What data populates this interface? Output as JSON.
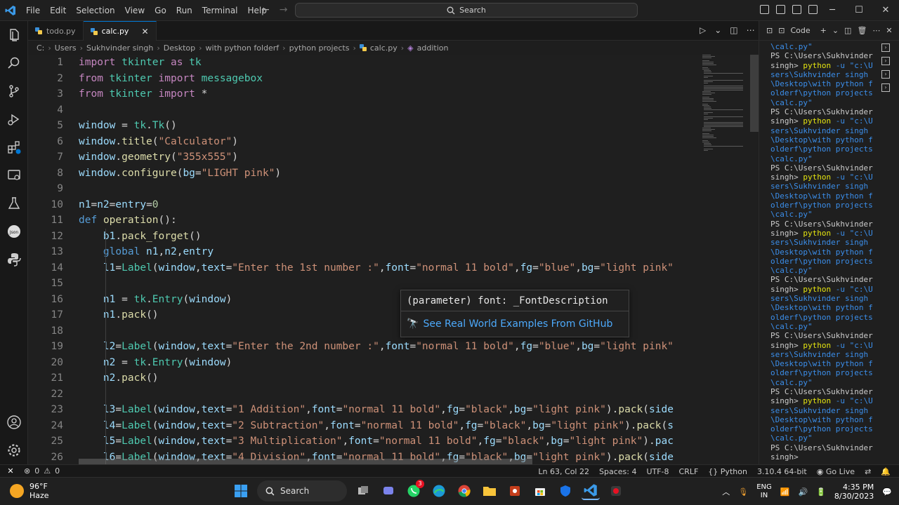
{
  "window": {
    "menu": [
      "File",
      "Edit",
      "Selection",
      "View",
      "Go",
      "Run",
      "Terminal",
      "Help"
    ],
    "search_label": "Search"
  },
  "tabs": [
    {
      "label": "todo.py",
      "active": false
    },
    {
      "label": "calc.py",
      "active": true
    }
  ],
  "breadcrumb": [
    "C:",
    "Users",
    "Sukhvinder singh",
    "Desktop",
    "with python folderf",
    "python projects",
    "calc.py",
    "addition"
  ],
  "editor": {
    "lines": [
      {
        "n": "1",
        "text": "import tkinter as tk"
      },
      {
        "n": "2",
        "text": "from tkinter import messagebox"
      },
      {
        "n": "3",
        "text": "from tkinter import *"
      },
      {
        "n": "4",
        "text": ""
      },
      {
        "n": "5",
        "text": "window = tk.Tk()"
      },
      {
        "n": "6",
        "text": "window.title(\"Calculator\")"
      },
      {
        "n": "7",
        "text": "window.geometry(\"355x555\")"
      },
      {
        "n": "8",
        "text": "window.configure(bg=\"LIGHT pink\")"
      },
      {
        "n": "9",
        "text": ""
      },
      {
        "n": "10",
        "text": "n1=n2=entry=0"
      },
      {
        "n": "11",
        "text": "def operation():"
      },
      {
        "n": "12",
        "text": "    b1.pack_forget()"
      },
      {
        "n": "13",
        "text": "    global n1,n2,entry"
      },
      {
        "n": "14",
        "text": "    l1=Label(window,text=\"Enter the 1st number :\",font=\"normal 11 bold\",fg=\"blue\",bg=\"light pink\""
      },
      {
        "n": "15",
        "text": ""
      },
      {
        "n": "16",
        "text": "    n1 = tk.Entry(window)"
      },
      {
        "n": "17",
        "text": "    n1.pack()"
      },
      {
        "n": "18",
        "text": ""
      },
      {
        "n": "19",
        "text": "    l2=Label(window,text=\"Enter the 2nd number :\",font=\"normal 11 bold\",fg=\"blue\",bg=\"light pink\""
      },
      {
        "n": "20",
        "text": "    n2 = tk.Entry(window)"
      },
      {
        "n": "21",
        "text": "    n2.pack()"
      },
      {
        "n": "22",
        "text": ""
      },
      {
        "n": "23",
        "text": "    l3=Label(window,text=\"1 Addition\",font=\"normal 11 bold\",fg=\"black\",bg=\"light pink\").pack(side"
      },
      {
        "n": "24",
        "text": "    l4=Label(window,text=\"2 Subtraction\",font=\"normal 11 bold\",fg=\"black\",bg=\"light pink\").pack(s"
      },
      {
        "n": "25",
        "text": "    l5=Label(window,text=\"3 Multiplication\",font=\"normal 11 bold\",fg=\"black\",bg=\"light pink\").pac"
      },
      {
        "n": "26",
        "text": "    l6=Label(window,text=\"4 Division\",font=\"normal 11 bold\",fg=\"black\",bg=\"light pink\").pack(side"
      }
    ]
  },
  "hover": {
    "signature": "(parameter) font: _FontDescription",
    "link": "See Real World Examples From GitHub"
  },
  "panel": {
    "title": "Code",
    "terminal": [
      {
        "t": "\\calc.py\"",
        "k": "str"
      },
      {
        "t": "PS C:\\Users\\Sukhvinder singh> ",
        "k": "ps"
      },
      {
        "t": "python",
        "k": "cmd"
      },
      {
        "t": " -u \"c:\\Users\\Sukhvinder singh\\Desktop\\with python folderf\\python projects\\calc.py\"",
        "k": "str"
      },
      {
        "t": "PS C:\\Users\\Sukhvinder singh> ",
        "k": "ps"
      },
      {
        "t": "python",
        "k": "cmd"
      },
      {
        "t": " -u \"c:\\Users\\Sukhvinder singh\\Desktop\\with python folderf\\python projects\\calc.py\"",
        "k": "str"
      },
      {
        "t": "PS C:\\Users\\Sukhvinder singh> ",
        "k": "ps"
      },
      {
        "t": "python",
        "k": "cmd"
      },
      {
        "t": " -u \"c:\\Users\\Sukhvinder singh\\Desktop\\with python folderf\\python projects\\calc.py\"",
        "k": "str"
      },
      {
        "t": "PS C:\\Users\\Sukhvinder singh> ",
        "k": "ps"
      },
      {
        "t": "python",
        "k": "cmd"
      },
      {
        "t": " -u \"c:\\Users\\Sukhvinder singh\\Desktop\\with python folderf\\python projects\\calc.py\"",
        "k": "str"
      },
      {
        "t": "PS C:\\Users\\Sukhvinder singh> ",
        "k": "ps"
      },
      {
        "t": "python",
        "k": "cmd"
      },
      {
        "t": " -u \"c:\\Users\\Sukhvinder singh\\Desktop\\with python folderf\\python projects\\calc.py\"",
        "k": "str"
      },
      {
        "t": "PS C:\\Users\\Sukhvinder singh> ",
        "k": "ps"
      },
      {
        "t": "python",
        "k": "cmd"
      },
      {
        "t": " -u \"c:\\Users\\Sukhvinder singh\\Desktop\\with python folderf\\python projects\\calc.py\"",
        "k": "str"
      },
      {
        "t": "PS C:\\Users\\Sukhvinder singh> ",
        "k": "ps"
      },
      {
        "t": "python",
        "k": "cmd"
      },
      {
        "t": " -u \"c:\\Users\\Sukhvinder singh\\Desktop\\with python folderf\\python projects\\calc.py\"",
        "k": "str"
      },
      {
        "t": "PS C:\\Users\\Sukhvinder singh>",
        "k": "ps"
      }
    ]
  },
  "statusbar": {
    "errors": "0",
    "warnings": "0",
    "position": "Ln 63, Col 22",
    "spaces": "Spaces: 4",
    "encoding": "UTF-8",
    "eol": "CRLF",
    "language": "Python",
    "interpreter": "3.10.4 64-bit",
    "golive": "Go Live"
  },
  "taskbar": {
    "temp": "96°F",
    "condition": "Haze",
    "search": "Search",
    "lang_top": "ENG",
    "lang_bottom": "IN",
    "time": "4:35 PM",
    "date": "8/30/2023",
    "whatsapp_badge": "3"
  },
  "colors": {
    "keyword": "#c586c0",
    "control": "#569cd6",
    "module": "#4ec9b0",
    "func": "#dcdcaa",
    "var": "#9cdcfe",
    "string": "#ce9178",
    "number": "#b5cea8",
    "accent": "#0078d4"
  }
}
